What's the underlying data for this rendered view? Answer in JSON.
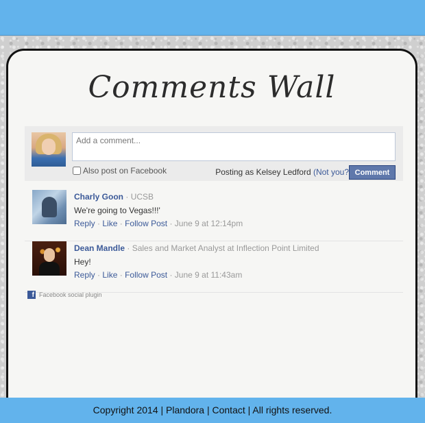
{
  "wall_title": "Comments Wall",
  "composer": {
    "placeholder": "Add a comment...",
    "also_post_label": "Also post on Facebook",
    "posting_as_prefix": "Posting as Kelsey Ledford",
    "not_you_label": "(Not you?)",
    "comment_button_label": "Comment"
  },
  "comments": [
    {
      "author": "Charly Goon",
      "affiliation": "UCSB",
      "text": "We're going to Vegas!!!'",
      "reply": "Reply",
      "like": "Like",
      "follow": "Follow Post",
      "timestamp": "June 9 at 12:14pm"
    },
    {
      "author": "Dean Mandle",
      "affiliation": "Sales and Market Analyst at Inflection Point Limited",
      "text": "Hey!",
      "reply": "Reply",
      "like": "Like",
      "follow": "Follow Post",
      "timestamp": "June 9 at 11:43am"
    }
  ],
  "plugin_label": "Facebook social plugin",
  "footer": {
    "copyright": "Copyright 2014",
    "site": "Plandora",
    "contact": "Contact",
    "rights": "All rights reserved."
  },
  "colors": {
    "header_footer": "#62b3ec",
    "link": "#3b5998",
    "button": "#5f78ab"
  }
}
